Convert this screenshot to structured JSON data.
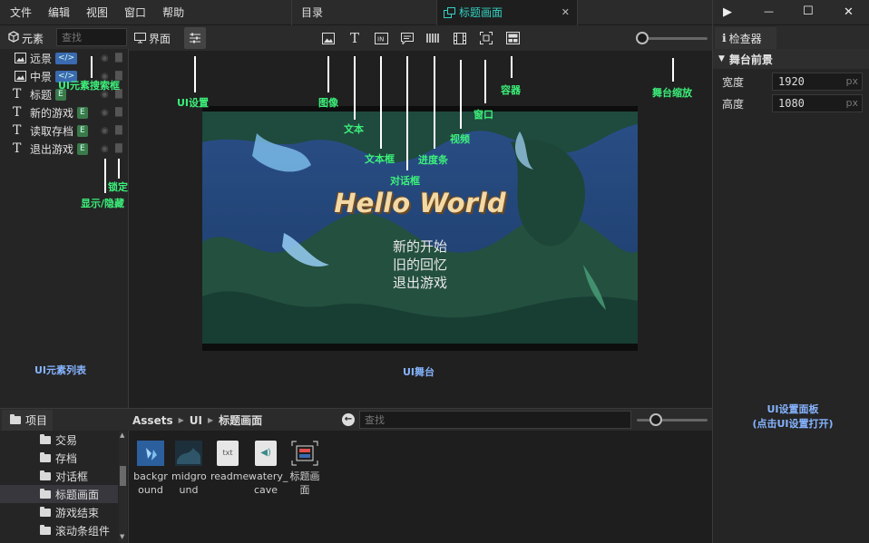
{
  "menu": [
    "文件",
    "编辑",
    "视图",
    "窗口",
    "帮助"
  ],
  "tabs": {
    "catalog": "目录",
    "title_screen": "标题画面",
    "close": "✕"
  },
  "window_controls": {
    "play": "▶",
    "minimize": "—",
    "maximize": "☐",
    "close": "✕"
  },
  "elements_panel": {
    "title": "元素",
    "search_placeholder": "查找",
    "items": [
      {
        "label": "远景",
        "badge": "</>"
      },
      {
        "label": "中景",
        "badge": "</>"
      },
      {
        "label": "标题",
        "badge": "E"
      },
      {
        "label": "新的游戏",
        "badge": "E"
      },
      {
        "label": "读取存档",
        "badge": "E"
      },
      {
        "label": "退出游戏",
        "badge": "E"
      }
    ]
  },
  "stage_toolbar": {
    "interface_tab": "界面"
  },
  "stage": {
    "title": "Hello World",
    "menu_lines": [
      "新的开始",
      "旧的回忆",
      "退出游戏"
    ]
  },
  "inspector": {
    "title": "检查器",
    "section": "舞台前景",
    "width_label": "宽度",
    "width_value": "1920",
    "height_label": "高度",
    "height_value": "1080",
    "unit": "px"
  },
  "project": {
    "title": "项目",
    "folders": [
      "交易",
      "存档",
      "对话框",
      "标题画面",
      "游戏结束",
      "滚动条组件"
    ],
    "breadcrumb": [
      "Assets",
      "UI",
      "标题画面"
    ],
    "search_placeholder": "查找",
    "assets": [
      {
        "name": "backgr\nound"
      },
      {
        "name": "midgro\nund"
      },
      {
        "name": "readme"
      },
      {
        "name": "watery_\ncave"
      },
      {
        "name": "标题画\n面"
      }
    ]
  },
  "annotations": {
    "search_box": "UI元素搜索框",
    "show_hide": "显示/隐藏",
    "lock": "锁定",
    "ui_settings": "UI设置",
    "image": "图像",
    "text": "文本",
    "textbox": "文本框",
    "dialog": "对话框",
    "progress": "进度条",
    "video": "视频",
    "window": "窗口",
    "container": "容器",
    "stage_zoom": "舞台缩放",
    "element_list": "UI元素列表",
    "ui_stage": "UI舞台",
    "settings_panel_1": "UI设置面板",
    "settings_panel_2": "(点击UI设置打开)"
  },
  "colors": {
    "accent_tab": "#33d0c0",
    "annotation": "#3cf07a",
    "annotation_blue": "#86b4ff"
  }
}
